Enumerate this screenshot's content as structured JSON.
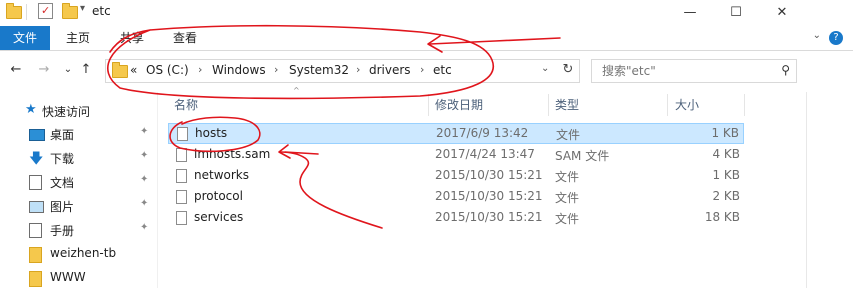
{
  "window": {
    "title": "etc",
    "minimize_glyph": "—",
    "maximize_glyph": "☐",
    "close_glyph": "✕"
  },
  "ribbon": {
    "tabs": [
      {
        "label": "文件"
      },
      {
        "label": "主页"
      },
      {
        "label": "共享"
      },
      {
        "label": "查看"
      }
    ],
    "collapse_glyph": "⌄",
    "help_glyph": "?"
  },
  "nav": {
    "back_glyph": "←",
    "forward_glyph": "→",
    "recent_glyph": "⌄",
    "up_glyph": "↑",
    "overflow": "«",
    "breadcrumbs": [
      "OS (C:)",
      "Windows",
      "System32",
      "drivers",
      "etc"
    ],
    "crumb_separator": "›",
    "dropdown_glyph": "⌄",
    "refresh_glyph": "↻"
  },
  "search": {
    "placeholder": "搜索\"etc\"",
    "icon_glyph": "⚲"
  },
  "sidebar": {
    "items": [
      {
        "label": "快速访问",
        "icon": "star-icon",
        "pinned": false
      },
      {
        "label": "桌面",
        "icon": "desktop-icon",
        "pinned": true
      },
      {
        "label": "下载",
        "icon": "download-icon",
        "pinned": true
      },
      {
        "label": "文档",
        "icon": "document-icon",
        "pinned": true
      },
      {
        "label": "图片",
        "icon": "picture-icon",
        "pinned": true
      },
      {
        "label": "手册",
        "icon": "folder-icon",
        "pinned": true
      },
      {
        "label": "weizhen-tb",
        "icon": "folder-icon",
        "pinned": false
      },
      {
        "label": "WWW",
        "icon": "folder-icon",
        "pinned": false
      }
    ],
    "pin_glyph": "📌"
  },
  "filelist": {
    "columns": {
      "name": "名称",
      "modified": "修改日期",
      "type": "类型",
      "size": "大小"
    },
    "sort_indicator": "^",
    "rows": [
      {
        "name": "hosts",
        "modified": "2017/6/9 13:42",
        "type": "文件",
        "size": "1 KB",
        "selected": true
      },
      {
        "name": "lmhosts.sam",
        "modified": "2017/4/24 13:47",
        "type": "SAM 文件",
        "size": "4 KB",
        "selected": false
      },
      {
        "name": "networks",
        "modified": "2015/10/30 15:21",
        "type": "文件",
        "size": "1 KB",
        "selected": false
      },
      {
        "name": "protocol",
        "modified": "2015/10/30 15:21",
        "type": "文件",
        "size": "2 KB",
        "selected": false
      },
      {
        "name": "services",
        "modified": "2015/10/30 15:21",
        "type": "文件",
        "size": "18 KB",
        "selected": false
      }
    ]
  },
  "colors": {
    "accent": "#1979ca",
    "selection_bg": "#cce8ff",
    "selection_border": "#99d1ff",
    "annotation_red": "#e0151c"
  }
}
